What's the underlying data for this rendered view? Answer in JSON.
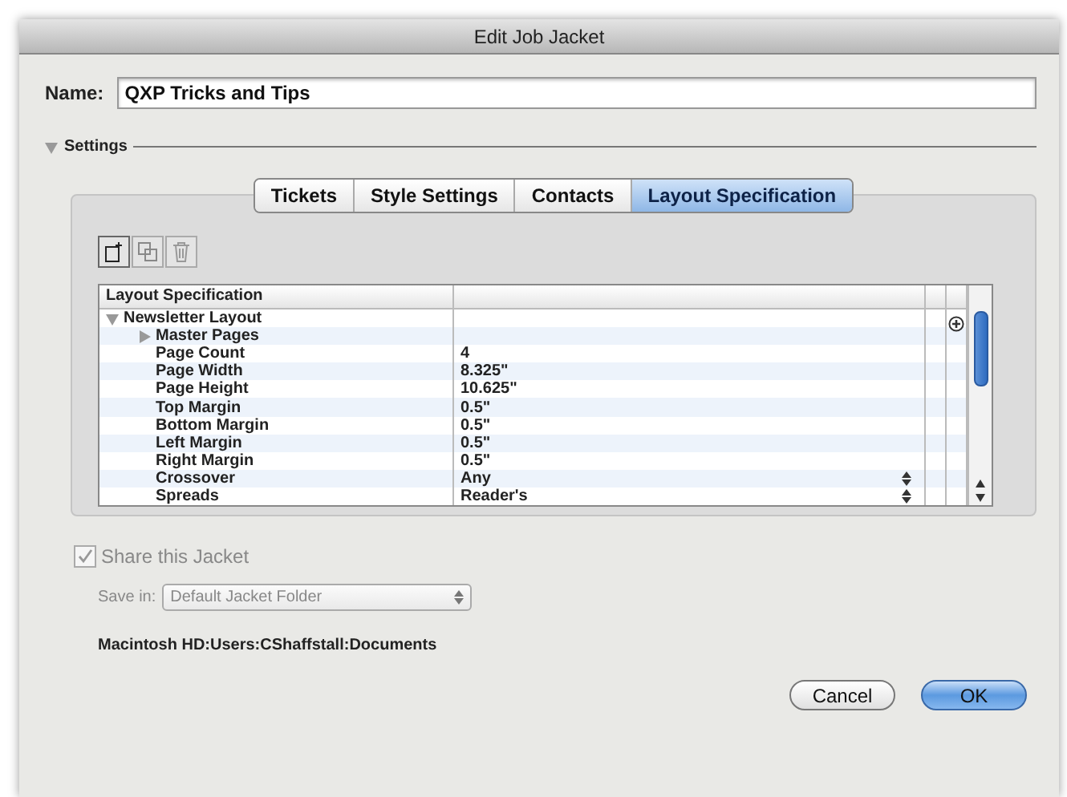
{
  "window": {
    "title": "Edit Job Jacket"
  },
  "name_field": {
    "label": "Name:",
    "value": "QXP Tricks and Tips"
  },
  "settings": {
    "label": "Settings",
    "expanded": true
  },
  "tabs": [
    {
      "label": "Tickets",
      "selected": false
    },
    {
      "label": "Style Settings",
      "selected": false
    },
    {
      "label": "Contacts",
      "selected": false
    },
    {
      "label": "Layout Specification",
      "selected": true
    }
  ],
  "toolbar": [
    {
      "kind": "new",
      "disabled": false
    },
    {
      "kind": "duplicate",
      "disabled": true
    },
    {
      "kind": "delete",
      "disabled": true
    }
  ],
  "table": {
    "columns": [
      "Layout Specification"
    ],
    "rows": [
      {
        "name": "Newsletter Layout",
        "expanded": true,
        "children": [
          {
            "name": "Master Pages",
            "expanded": false
          },
          {
            "name": "Page Count",
            "value": "4",
            "kind": "text"
          },
          {
            "name": "Page Width",
            "value": "8.325\"",
            "kind": "text"
          },
          {
            "name": "Page Height",
            "value": "10.625\"",
            "kind": "text"
          },
          {
            "name": "Top Margin",
            "value": "0.5\"",
            "kind": "text"
          },
          {
            "name": "Bottom Margin",
            "value": "0.5\"",
            "kind": "text"
          },
          {
            "name": "Left Margin",
            "value": "0.5\"",
            "kind": "text"
          },
          {
            "name": "Right Margin",
            "value": "0.5\"",
            "kind": "text"
          },
          {
            "name": "Crossover",
            "value": "Any",
            "kind": "select"
          },
          {
            "name": "Spreads",
            "value": "Reader's",
            "kind": "select"
          }
        ]
      }
    ]
  },
  "share": {
    "label": "Share this Jacket",
    "checked": true,
    "disabled": true
  },
  "save_in": {
    "label": "Save in:",
    "value": "Default Jacket Folder",
    "disabled": true
  },
  "path": "Macintosh HD:Users:CShaffstall:Documents",
  "buttons": [
    {
      "label": "Cancel",
      "kind": "cancel"
    },
    {
      "label": "OK",
      "kind": "default"
    }
  ]
}
